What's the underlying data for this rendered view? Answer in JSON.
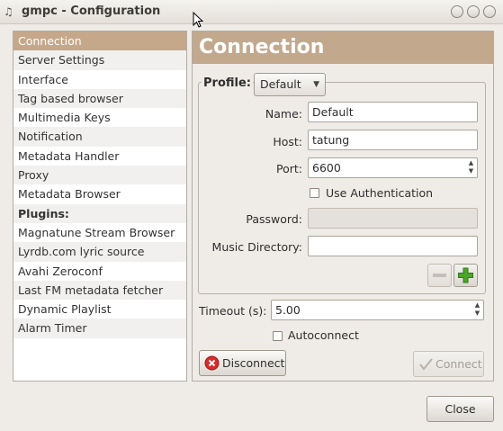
{
  "window": {
    "title": "gmpc - Configuration"
  },
  "sidebar": {
    "items": [
      {
        "label": "Connection"
      },
      {
        "label": "Server Settings"
      },
      {
        "label": "Interface"
      },
      {
        "label": "Tag based browser"
      },
      {
        "label": "Multimedia Keys"
      },
      {
        "label": "Notification"
      },
      {
        "label": "Metadata Handler"
      },
      {
        "label": "Proxy"
      },
      {
        "label": "Metadata Browser"
      },
      {
        "label": "Plugins:"
      },
      {
        "label": "Magnatune Stream Browser"
      },
      {
        "label": "Lyrdb.com lyric source"
      },
      {
        "label": "Avahi Zeroconf"
      },
      {
        "label": "Last FM metadata fetcher"
      },
      {
        "label": "Dynamic Playlist"
      },
      {
        "label": "Alarm Timer"
      }
    ]
  },
  "panel": {
    "header": "Connection",
    "profile_label": "Profile:",
    "profile_value": "Default",
    "name_label": "Name:",
    "name_value": "Default",
    "host_label": "Host:",
    "host_value": "tatung",
    "port_label": "Port:",
    "port_value": "6600",
    "use_auth_label": "Use Authentication",
    "password_label": "Password:",
    "password_value": "",
    "music_dir_label": "Music Directory:",
    "music_dir_value": "",
    "timeout_label": "Timeout (s):",
    "timeout_value": "5.00",
    "autoconnect_label": "Autoconnect",
    "disconnect_label": "Disconnect",
    "connect_label": "Connect"
  },
  "footer": {
    "close_label": "Close"
  },
  "colors": {
    "selection": "#c5a78a",
    "header": "#c2a88c",
    "disconnect_icon": "#d62b2b",
    "add_icon": "#4ba52a"
  }
}
